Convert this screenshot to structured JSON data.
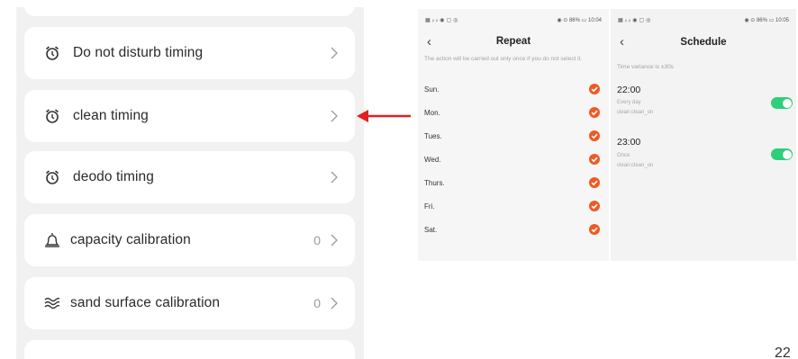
{
  "settings": {
    "items": [
      {
        "label": "Do not disturb timing",
        "value": "",
        "icon": "alarm-clock-icon"
      },
      {
        "label": "clean timing",
        "value": "",
        "icon": "alarm-clock-icon"
      },
      {
        "label": "deodo timing",
        "value": "",
        "icon": "alarm-clock-icon"
      },
      {
        "label": "capacity calibration",
        "value": "0",
        "icon": "bell-icon"
      },
      {
        "label": "sand surface calibration",
        "value": "0",
        "icon": "waves-icon"
      }
    ]
  },
  "annotation": {
    "arrow_color": "#e02020",
    "points_to": "clean timing"
  },
  "repeat_screen": {
    "status_left": "▦ ᵢₗ ᵢₗ ◉ ▢ ◎",
    "status_right": "◉ ⊙ 86% ▭ 10:04",
    "back": "‹",
    "title": "Repeat",
    "note": "The action will be carried out only once if you do not select it.",
    "days": [
      "Sun.",
      "Mon.",
      "Tues.",
      "Wed.",
      "Thurs.",
      "Fri.",
      "Sat."
    ],
    "check_color": "#f05a22"
  },
  "schedule_screen": {
    "status_left": "▦ ᵢₗ ᵢₗ ◉ ▢ ◎",
    "status_right": "◉ ⊙ 86% ▭ 10:05",
    "back": "‹",
    "title": "Schedule",
    "note": "Time variance is ±30s",
    "entries": [
      {
        "time": "22:00",
        "repeat": "Every day",
        "action": "clean:clean_on",
        "enabled": true
      },
      {
        "time": "23:00",
        "repeat": "Once",
        "action": "clean:clean_on",
        "enabled": true
      }
    ],
    "toggle_color": "#2ecf7a"
  },
  "page_number": "22"
}
